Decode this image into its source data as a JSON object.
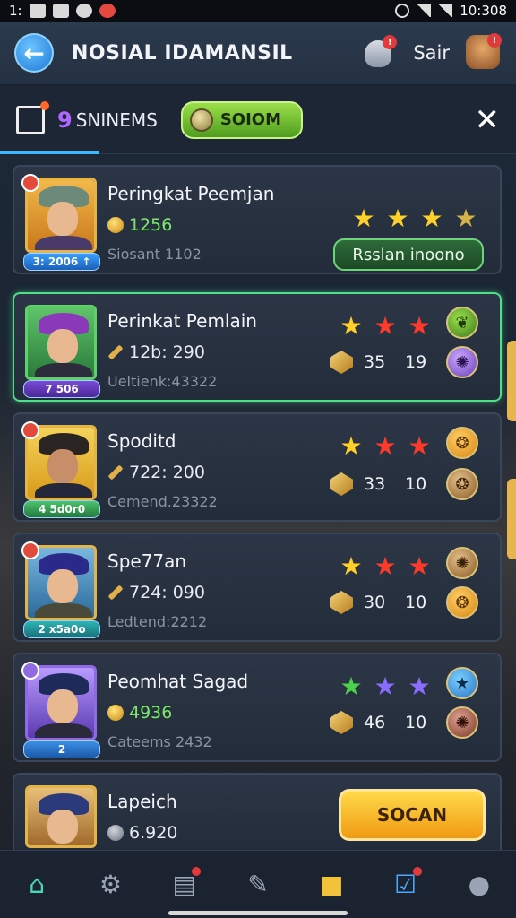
{
  "status_bar": {
    "left_text": "1:",
    "time": "10:308"
  },
  "header": {
    "title": "NOSIAL IDAMANSIL",
    "right_label": "Sair",
    "notif_badge": "!",
    "avatar_badge": "!"
  },
  "tabs": {
    "num": "9",
    "label": "SNINEMS",
    "pill_label": "SOIOM"
  },
  "cards": [
    {
      "name": "Peringkat Peemjan",
      "score": "1256",
      "sub": "Siosant 1102",
      "level": "3: 2006 ↑",
      "stars": [
        "gold",
        "gold",
        "gold",
        "gold-outline"
      ],
      "action": "Rsslan inoono"
    },
    {
      "name": "Perinkat Pemlain",
      "score": "12b: 290",
      "sub": "Ueltienk:43322",
      "level": "7 506",
      "stars": [
        "gold",
        "red",
        "red"
      ],
      "gem1": "35",
      "gem2": "19"
    },
    {
      "name": "Spoditd",
      "score": "722: 200",
      "sub": "Cemend.23322",
      "level": "4 5d0r0",
      "stars": [
        "gold",
        "red",
        "red"
      ],
      "gem1": "33",
      "gem2": "10"
    },
    {
      "name": "Spe77an",
      "score": "724: 090",
      "sub": "Ledtend:2212",
      "level": "2 x5a0o",
      "stars": [
        "gold",
        "red",
        "red"
      ],
      "gem1": "30",
      "gem2": "10"
    },
    {
      "name": "Peomhat Sagad",
      "score": "4936",
      "sub": "Cateems 2432",
      "level": "2",
      "stars": [
        "green",
        "purple",
        "purple"
      ],
      "gem1": "46",
      "gem2": "10"
    },
    {
      "name": "Lapeich",
      "score": "6.920",
      "action": "SOCAN"
    }
  ],
  "colors": {
    "accent": "#3fb6ff",
    "selected": "#4fe08a"
  },
  "nav": [
    "home-icon",
    "gear-icon",
    "mail-icon",
    "pen-icon",
    "shop-icon",
    "quests-icon",
    "profile-icon"
  ]
}
